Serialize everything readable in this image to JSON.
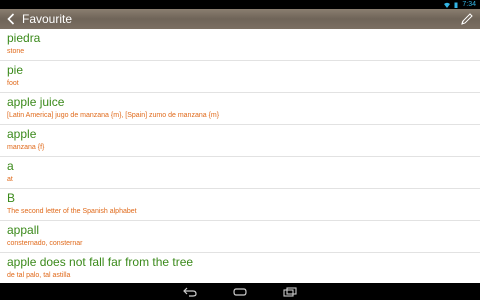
{
  "status": {
    "time": "7:34"
  },
  "actionbar": {
    "title": "Favourite"
  },
  "items": [
    {
      "word": "piedra",
      "def": "stone"
    },
    {
      "word": "pie",
      "def": "foot"
    },
    {
      "word": "apple juice",
      "def": "[Latin America] jugo de manzana {m}, [Spain] zumo de manzana {m}"
    },
    {
      "word": "apple",
      "def": "manzana {f}"
    },
    {
      "word": "a",
      "def": "at"
    },
    {
      "word": "B",
      "def": "The second letter of the Spanish alphabet"
    },
    {
      "word": "appall",
      "def": "consternado, consternar"
    },
    {
      "word": "apple does not fall far from the tree",
      "def": "de tal palo, tal astilla"
    }
  ],
  "colors": {
    "word": "#3b8a1b",
    "def": "#e06a1b",
    "accent": "#33b5e5"
  },
  "icons": [
    "back-icon",
    "edit-icon",
    "nav-back-icon",
    "nav-home-icon",
    "nav-recents-icon",
    "wifi-icon",
    "battery-icon"
  ]
}
